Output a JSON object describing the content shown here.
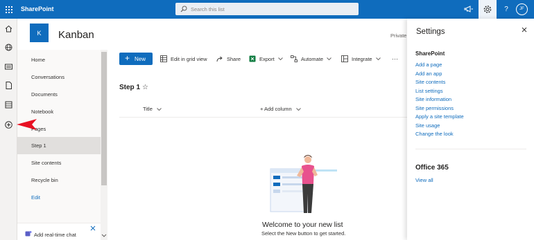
{
  "suite_bar": {
    "app_name": "SharePoint",
    "search_placeholder": "Search this list",
    "user_initials": "JF",
    "help_label": "?"
  },
  "site": {
    "logo_letter": "K",
    "title": "Kanban",
    "privacy": "Private g"
  },
  "left_nav": {
    "items": [
      {
        "label": "Home"
      },
      {
        "label": "Conversations"
      },
      {
        "label": "Documents"
      },
      {
        "label": "Notebook"
      },
      {
        "label": "Pages"
      },
      {
        "label": "Step 1"
      },
      {
        "label": "Site contents"
      },
      {
        "label": "Recycle bin"
      },
      {
        "label": "Edit"
      }
    ],
    "selected": "Step 1"
  },
  "chat_panel": {
    "label": "Add real-time chat"
  },
  "command_bar": {
    "new_label": "New",
    "edit_grid_label": "Edit in grid view",
    "share_label": "Share",
    "export_label": "Export",
    "automate_label": "Automate",
    "integrate_label": "Integrate",
    "more_label": "···"
  },
  "list": {
    "title": "Step 1",
    "favorite_icon": "☆",
    "column_title": "Title",
    "add_column": "+ Add column",
    "empty_title": "Welcome to your new list",
    "empty_subtitle": "Select the New button to get started."
  },
  "settings_panel": {
    "title": "Settings",
    "sharepoint_heading": "SharePoint",
    "links": [
      "Add a page",
      "Add an app",
      "Site contents",
      "List settings",
      "Site information",
      "Site permissions",
      "Apply a site template",
      "Site usage",
      "Change the look"
    ],
    "office_heading": "Office 365",
    "office_link": "View all"
  },
  "colors": {
    "brand": "#0f6cbd",
    "pointer": "#e81123"
  }
}
